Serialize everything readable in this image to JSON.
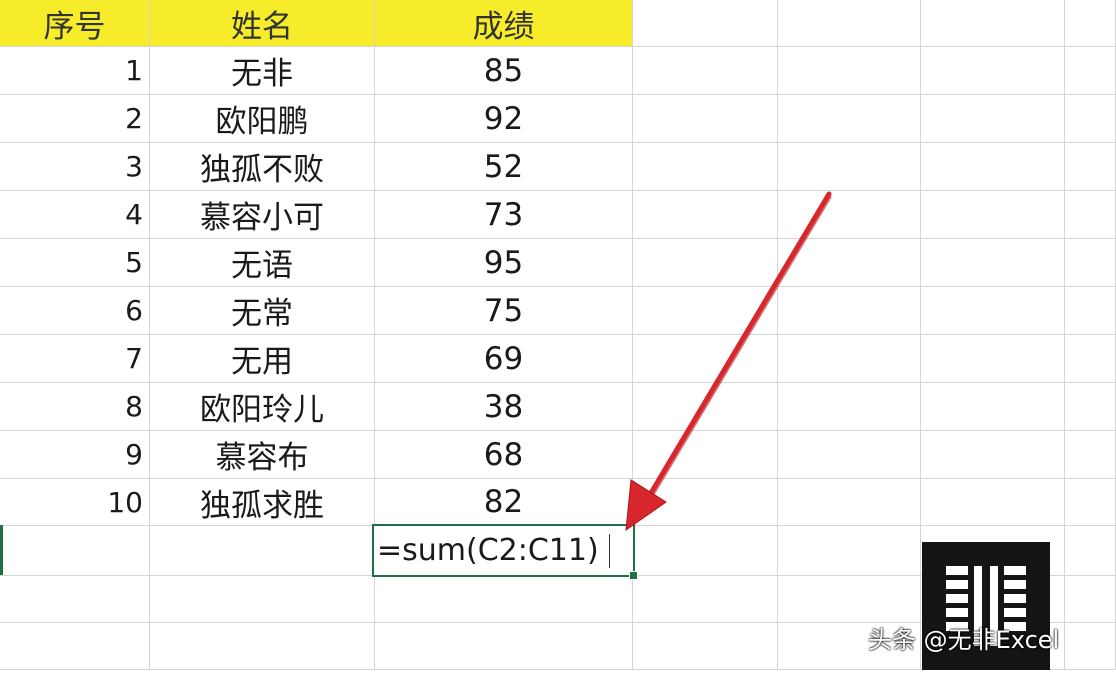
{
  "headers": [
    "序号",
    "姓名",
    "成绩"
  ],
  "rows": [
    {
      "no": "1",
      "name": "无非",
      "score": "85"
    },
    {
      "no": "2",
      "name": "欧阳鹏",
      "score": "92"
    },
    {
      "no": "3",
      "name": "独孤不败",
      "score": "52"
    },
    {
      "no": "4",
      "name": "慕容小可",
      "score": "73"
    },
    {
      "no": "5",
      "name": "无语",
      "score": "95"
    },
    {
      "no": "6",
      "name": "无常",
      "score": "75"
    },
    {
      "no": "7",
      "name": "无用",
      "score": "69"
    },
    {
      "no": "8",
      "name": "欧阳玲儿",
      "score": "38"
    },
    {
      "no": "9",
      "name": "慕容布",
      "score": "68"
    },
    {
      "no": "10",
      "name": "独孤求胜",
      "score": "82"
    }
  ],
  "active_cell": {
    "formula": "=sum(C2:C11)"
  },
  "watermark": "头条 @无非Excel",
  "colors": {
    "header_highlight": "#f7ec2a",
    "selection": "#1e7145",
    "arrow": "#d9262c"
  }
}
